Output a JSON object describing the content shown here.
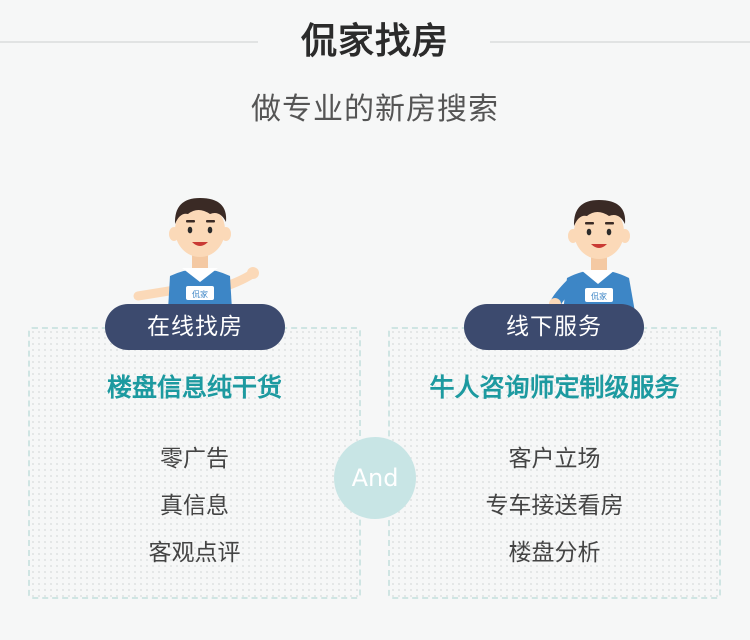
{
  "header": {
    "title": "侃家找房",
    "subtitle": "做专业的新房搜索"
  },
  "left_card": {
    "pill": "在线找房",
    "headline": "楼盘信息纯干货",
    "items": [
      "零广告",
      "真信息",
      "客观点评"
    ],
    "mascot_shirt_text": "侃家"
  },
  "right_card": {
    "pill": "线下服务",
    "headline": "牛人咨询师定制级服务",
    "items": [
      "客户立场",
      "专车接送看房",
      "楼盘分析"
    ],
    "mascot_shirt_text": "侃家"
  },
  "connector": "And",
  "colors": {
    "accent": "#1d9aa0",
    "pill": "#3c4a6e",
    "circle": "#c8e5e5",
    "background": "#f6f7f7"
  }
}
